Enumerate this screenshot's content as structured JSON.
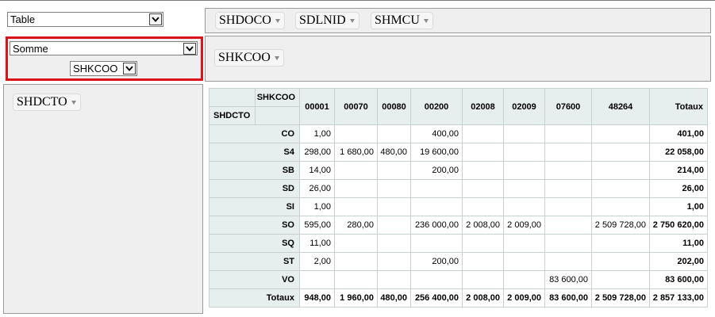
{
  "renderer": {
    "selected": "Table"
  },
  "aggregator": {
    "selected": "Somme",
    "attribute": "SHKCOO"
  },
  "col_attrs": [
    "SHDOCO",
    "SDLNID",
    "SHMCU"
  ],
  "row_area_attrs": [
    "SHKCOO"
  ],
  "unused_attrs": [
    "SHDCTO"
  ],
  "table": {
    "col_attr": "SHKCOO",
    "row_attr": "SHDCTO",
    "columns": [
      "00001",
      "00070",
      "00080",
      "00200",
      "02008",
      "02009",
      "07600",
      "48264"
    ],
    "totals_label": "Totaux",
    "rows": [
      {
        "key": "CO",
        "cells": [
          "1,00",
          "",
          "",
          "400,00",
          "",
          "",
          "",
          ""
        ],
        "total": "401,00"
      },
      {
        "key": "S4",
        "cells": [
          "298,00",
          "1 680,00",
          "480,00",
          "19 600,00",
          "",
          "",
          "",
          ""
        ],
        "total": "22 058,00"
      },
      {
        "key": "SB",
        "cells": [
          "14,00",
          "",
          "",
          "200,00",
          "",
          "",
          "",
          ""
        ],
        "total": "214,00"
      },
      {
        "key": "SD",
        "cells": [
          "26,00",
          "",
          "",
          "",
          "",
          "",
          "",
          ""
        ],
        "total": "26,00"
      },
      {
        "key": "SI",
        "cells": [
          "1,00",
          "",
          "",
          "",
          "",
          "",
          "",
          ""
        ],
        "total": "1,00"
      },
      {
        "key": "SO",
        "cells": [
          "595,00",
          "280,00",
          "",
          "236 000,00",
          "2 008,00",
          "2 009,00",
          "",
          "2 509 728,00"
        ],
        "total": "2 750 620,00"
      },
      {
        "key": "SQ",
        "cells": [
          "11,00",
          "",
          "",
          "",
          "",
          "",
          "",
          ""
        ],
        "total": "11,00"
      },
      {
        "key": "ST",
        "cells": [
          "2,00",
          "",
          "",
          "200,00",
          "",
          "",
          "",
          ""
        ],
        "total": "202,00"
      },
      {
        "key": "VO",
        "cells": [
          "",
          "",
          "",
          "",
          "",
          "",
          "83 600,00",
          ""
        ],
        "total": "83 600,00"
      }
    ],
    "col_totals": [
      "948,00",
      "1 960,00",
      "480,00",
      "256 400,00",
      "2 008,00",
      "2 009,00",
      "83 600,00",
      "2 509 728,00"
    ],
    "grand_total": "2 857 133,00"
  }
}
